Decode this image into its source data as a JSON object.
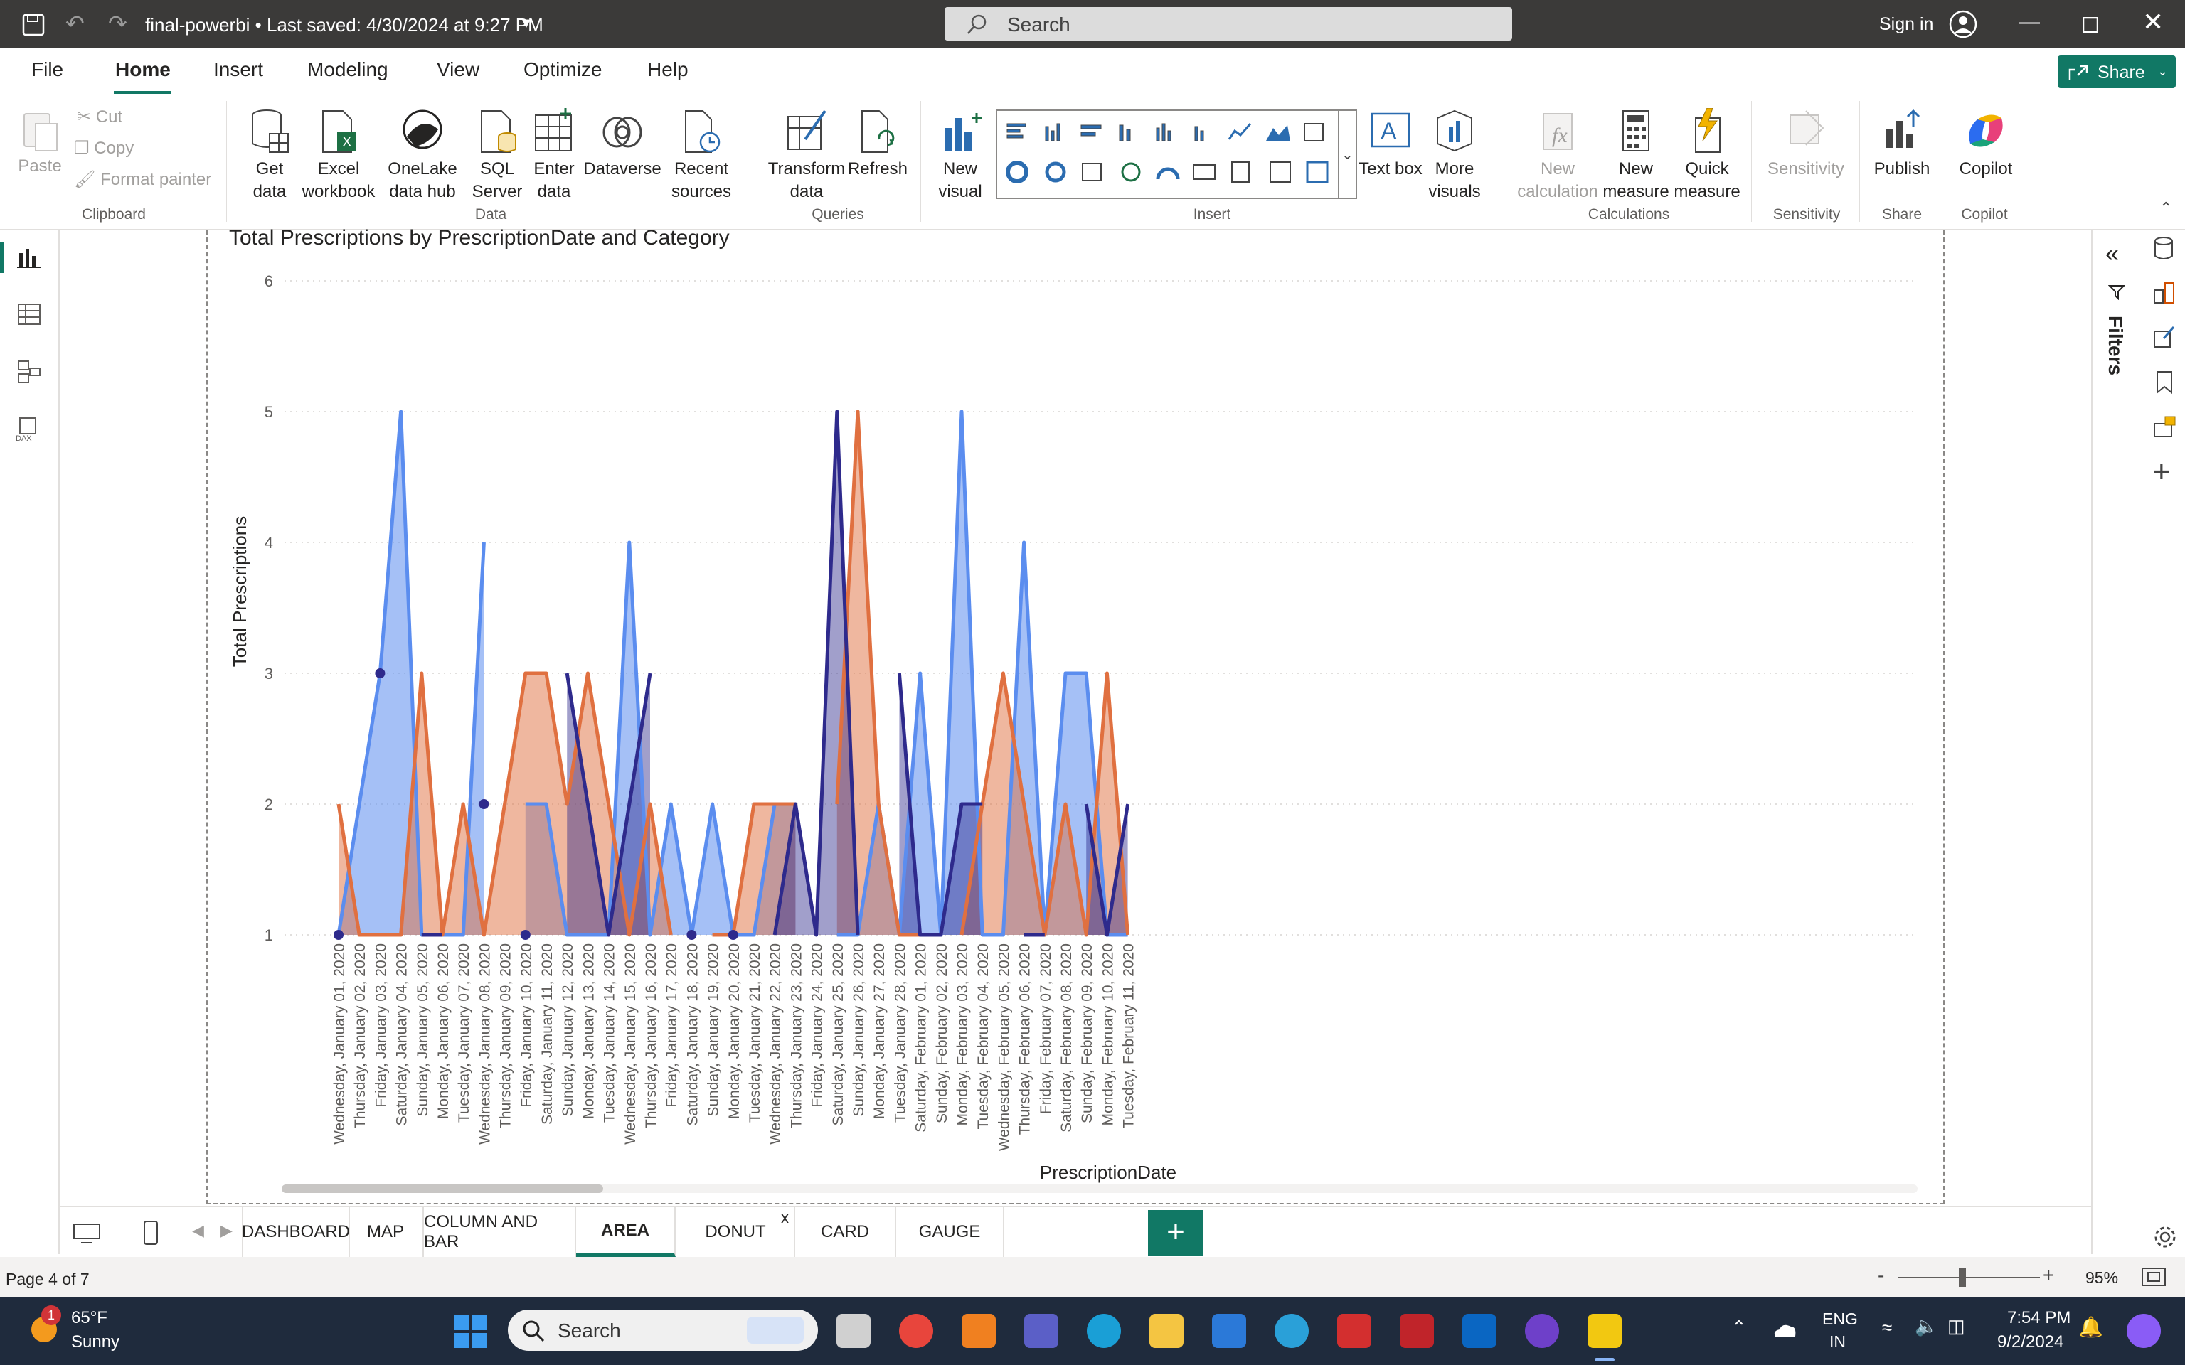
{
  "titlebar": {
    "title": "final-powerbi • Last saved: 4/30/2024 at 9:27 PM",
    "search_placeholder": "Search",
    "signin": "Sign in"
  },
  "menu": {
    "items": [
      "File",
      "Home",
      "Insert",
      "Modeling",
      "View",
      "Optimize",
      "Help"
    ],
    "active": "Home",
    "share": "Share"
  },
  "ribbon": {
    "clipboard": {
      "paste": "Paste",
      "cut": "Cut",
      "copy": "Copy",
      "format_painter": "Format painter",
      "group": "Clipboard"
    },
    "data": {
      "get_data": "Get data",
      "excel": "Excel workbook",
      "onelake": "OneLake data hub",
      "sql": "SQL Server",
      "enter": "Enter data",
      "dataverse": "Dataverse",
      "recent": "Recent sources",
      "group": "Data"
    },
    "queries": {
      "transform": "Transform data",
      "refresh": "Refresh",
      "group": "Queries"
    },
    "insert": {
      "new_visual": "New visual",
      "text_box": "Text box",
      "more_visuals": "More visuals",
      "group": "Insert"
    },
    "calculations": {
      "new_calc": "New calculation",
      "new_measure": "New measure",
      "quick_measure": "Quick measure",
      "group": "Calculations"
    },
    "sensitivity": {
      "label": "Sensitivity",
      "group": "Sensitivity"
    },
    "share": {
      "publish": "Publish",
      "group": "Share"
    },
    "copilot": {
      "label": "Copilot",
      "group": "Copilot"
    }
  },
  "filters_label": "Filters",
  "chart_data": {
    "type": "area",
    "title": "Total Prescriptions by PrescriptionDate and Category",
    "xlabel": "PrescriptionDate",
    "ylabel": "Total Prescriptions",
    "ylim": [
      1,
      6
    ],
    "yticks": [
      1,
      2,
      3,
      4,
      5,
      6
    ],
    "grid": true,
    "colors": [
      "#5b8def",
      "#e07040",
      "#2e2a8c"
    ],
    "categories": [
      "Wednesday, January 01, 2020",
      "Thursday, January 02, 2020",
      "Friday, January 03, 2020",
      "Saturday, January 04, 2020",
      "Sunday, January 05, 2020",
      "Monday, January 06, 2020",
      "Tuesday, January 07, 2020",
      "Wednesday, January 08, 2020",
      "Thursday, January 09, 2020",
      "Friday, January 10, 2020",
      "Saturday, January 11, 2020",
      "Sunday, January 12, 2020",
      "Monday, January 13, 2020",
      "Tuesday, January 14, 2020",
      "Wednesday, January 15, 2020",
      "Thursday, January 16, 2020",
      "Friday, January 17, 2020",
      "Saturday, January 18, 2020",
      "Sunday, January 19, 2020",
      "Monday, January 20, 2020",
      "Tuesday, January 21, 2020",
      "Wednesday, January 22, 2020",
      "Thursday, January 23, 2020",
      "Friday, January 24, 2020",
      "Saturday, January 25, 2020",
      "Sunday, January 26, 2020",
      "Monday, January 27, 2020",
      "Tuesday, January 28, 2020",
      "Saturday, February 01, 2020",
      "Sunday, February 02, 2020",
      "Monday, February 03, 2020",
      "Tuesday, February 04, 2020",
      "Wednesday, February 05, 2020",
      "Thursday, February 06, 2020",
      "Friday, February 07, 2020",
      "Saturday, February 08, 2020",
      "Sunday, February 09, 2020",
      "Monday, February 10, 2020",
      "Tuesday, February 11, 2020"
    ],
    "series": [
      {
        "values": [
          1,
          2,
          3,
          5,
          1,
          1,
          1,
          4,
          null,
          2,
          2,
          1,
          1,
          1,
          4,
          1,
          2,
          1,
          2,
          1,
          1,
          2,
          2,
          null,
          1,
          1,
          2,
          1,
          3,
          1,
          5,
          1,
          1,
          4,
          1,
          3,
          3,
          1,
          1
        ]
      },
      {
        "values": [
          2,
          1,
          1,
          1,
          3,
          1,
          2,
          1,
          2,
          3,
          3,
          2,
          3,
          2,
          1,
          2,
          1,
          null,
          1,
          1,
          2,
          2,
          2,
          null,
          2,
          5,
          2,
          1,
          1,
          null,
          1,
          2,
          3,
          2,
          1,
          2,
          1,
          3,
          1
        ]
      },
      {
        "values": [
          1,
          null,
          3,
          null,
          1,
          1,
          null,
          2,
          null,
          1,
          null,
          3,
          2,
          1,
          2,
          3,
          null,
          1,
          null,
          1,
          null,
          1,
          2,
          1,
          5,
          1,
          null,
          3,
          1,
          1,
          2,
          2,
          null,
          1,
          1,
          null,
          2,
          1,
          2
        ]
      }
    ]
  },
  "tabs": [
    "DASHBOARD",
    "MAP",
    "COLUMN AND BAR",
    "AREA",
    "DONUT",
    "CARD",
    "GAUGE"
  ],
  "active_tab": "AREA",
  "add_page": "+",
  "status": {
    "page": "Page 4 of 7",
    "zoom": "95%"
  },
  "taskbar": {
    "weather_temp": "65°F",
    "weather_cond": "Sunny",
    "weather_badge": "1",
    "search": "Search",
    "lang": "ENG",
    "region": "IN",
    "time": "7:54 PM",
    "date": "9/2/2024"
  }
}
